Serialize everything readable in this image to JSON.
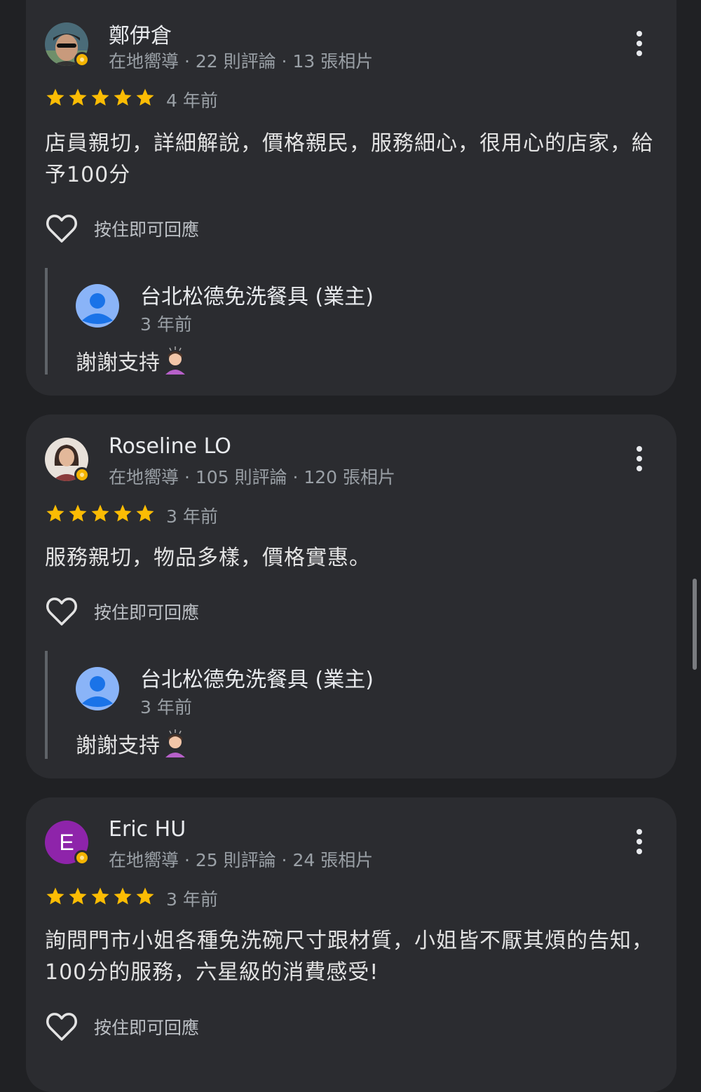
{
  "react_label": "按住即可回應",
  "reviews": [
    {
      "name": "鄭伊倉",
      "meta": "在地嚮導 · 22 則評論 · 13 張相片",
      "rating": 5,
      "age": "4 年前",
      "text": "店員親切，詳細解說，價格親民，服務細心，很用心的店家，給予100分",
      "avatar": "photo-man-cap",
      "reply": {
        "name": "台北松德免洗餐具 (業主)",
        "age": "3 年前",
        "text": "謝謝支持"
      }
    },
    {
      "name": "Roseline LO",
      "meta": "在地嚮導 · 105 則評論 · 120 張相片",
      "rating": 5,
      "age": "3 年前",
      "text": "服務親切，物品多樣，價格實惠。",
      "avatar": "photo-woman",
      "reply": {
        "name": "台北松德免洗餐具 (業主)",
        "age": "3 年前",
        "text": "謝謝支持"
      }
    },
    {
      "name": "Eric HU",
      "meta": "在地嚮導 · 25 則評論 · 24 張相片",
      "rating": 5,
      "age": "3 年前",
      "text": "詢問門市小姐各種免洗碗尺寸跟材質，小姐皆不厭其煩的告知，100分的服務，六星級的消費感受!",
      "avatar_letter": "E",
      "avatar_color": "#8e24aa"
    }
  ],
  "colors": {
    "star": "#fbbc04",
    "badge": "#f4b400",
    "owner_avatar": "#8ab4f8"
  }
}
